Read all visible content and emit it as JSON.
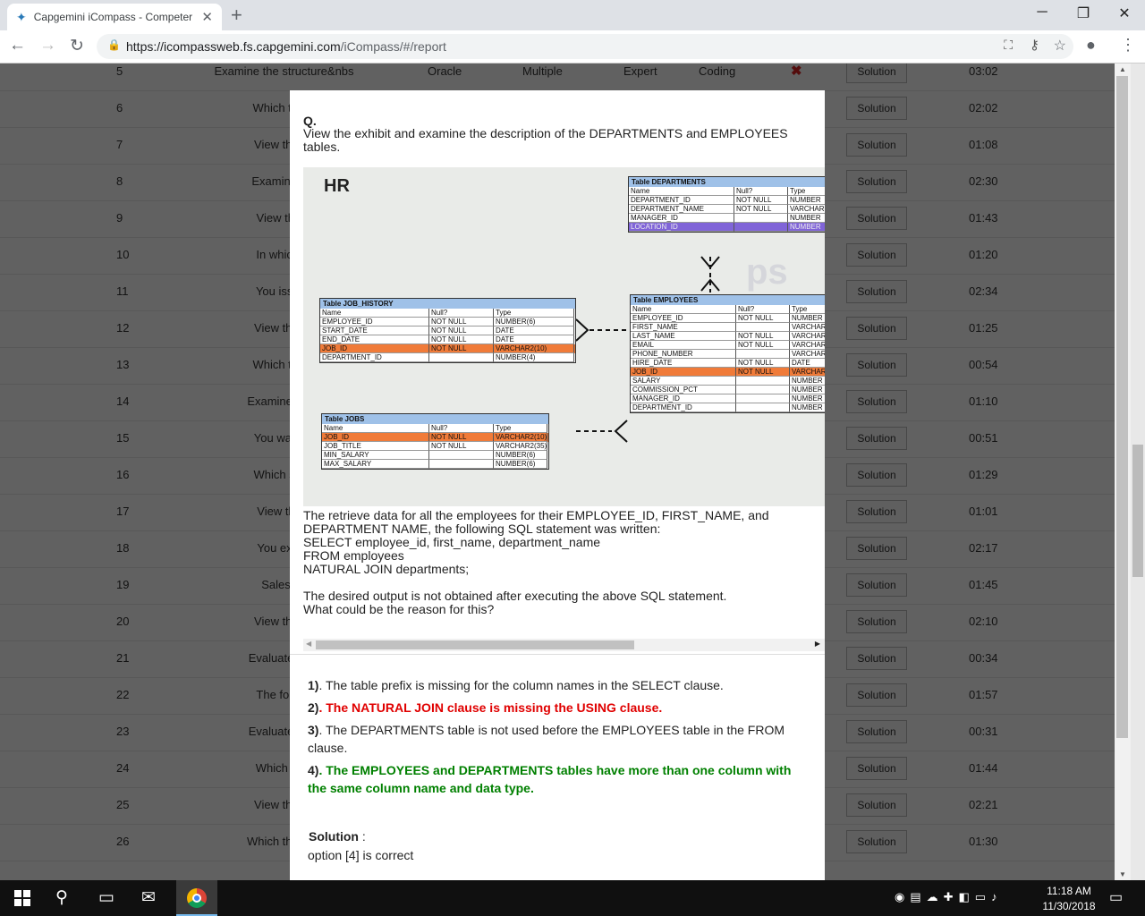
{
  "browser": {
    "tab_title": "Capgemini iCompass - Competer",
    "url_host": "https://icompassweb.fs.capgemini.com",
    "url_path": "/iCompass/#/report"
  },
  "table": {
    "solution_label": "Solution",
    "rows": [
      {
        "num": "5",
        "question": "Examine the structure&nbs",
        "c3": "Oracle",
        "c4": "Multiple",
        "c5": "Expert",
        "c6": "Coding",
        "wrong": true,
        "time": "03:02"
      },
      {
        "num": "6",
        "question": "Which two s",
        "time": "02:02"
      },
      {
        "num": "7",
        "question": "View the ex",
        "time": "01:08"
      },
      {
        "num": "8",
        "question": "Examine the",
        "time": "02:30"
      },
      {
        "num": "9",
        "question": "View the E",
        "time": "01:43"
      },
      {
        "num": "10",
        "question": "In which th",
        "time": "01:20"
      },
      {
        "num": "11",
        "question": "You issue t",
        "time": "02:34"
      },
      {
        "num": "12",
        "question": "View the ex",
        "time": "01:25"
      },
      {
        "num": "13",
        "question": "Which two s",
        "time": "00:54"
      },
      {
        "num": "14",
        "question": "Examine the s",
        "time": "01:10"
      },
      {
        "num": "15",
        "question": "You want to",
        "time": "00:51"
      },
      {
        "num": "16",
        "question": "Which state",
        "time": "01:29"
      },
      {
        "num": "17",
        "question": "View the e",
        "time": "01:01"
      },
      {
        "num": "18",
        "question": "You execu",
        "time": "02:17"
      },
      {
        "num": "19",
        "question": "Sales da",
        "time": "01:45"
      },
      {
        "num": "20",
        "question": "View the ex",
        "time": "02:10"
      },
      {
        "num": "21",
        "question": "Evaluate the f",
        "time": "00:34"
      },
      {
        "num": "22",
        "question": "The followi",
        "time": "01:57"
      },
      {
        "num": "23",
        "question": "Evaluate the f",
        "time": "00:31"
      },
      {
        "num": "24",
        "question": "Which task",
        "time": "01:44"
      },
      {
        "num": "25",
        "question": "View the ex",
        "time": "02:21"
      },
      {
        "num": "26",
        "question": "Which three st",
        "time": "01:30"
      }
    ]
  },
  "modal": {
    "q_label": "Q.",
    "question": "View the exhibit and examine the description of the DEPARTMENTS and EMPLOYEES tables.",
    "exhibit": {
      "schema": "HR",
      "departments": {
        "title": "Table DEPARTMENTS",
        "header": [
          "Name",
          "Null?",
          "Type"
        ],
        "rows": [
          [
            "DEPARTMENT_ID",
            "NOT NULL",
            "NUMBER"
          ],
          [
            "DEPARTMENT_NAME",
            "NOT NULL",
            "VARCHAR"
          ],
          [
            "MANAGER_ID",
            "",
            "NUMBER"
          ],
          [
            "LOCATION_ID",
            "",
            "NUMBER"
          ]
        ]
      },
      "employees": {
        "title": "Table EMPLOYEES",
        "header": [
          "Name",
          "Null?",
          "Type"
        ],
        "rows": [
          [
            "EMPLOYEE_ID",
            "NOT NULL",
            "NUMBER"
          ],
          [
            "FIRST_NAME",
            "",
            "VARCHAR"
          ],
          [
            "LAST_NAME",
            "NOT NULL",
            "VARCHAR"
          ],
          [
            "EMAIL",
            "NOT NULL",
            "VARCHAR"
          ],
          [
            "PHONE_NUMBER",
            "",
            "VARCHAR"
          ],
          [
            "HIRE_DATE",
            "NOT NULL",
            "DATE"
          ],
          [
            "JOB_ID",
            "NOT NULL",
            "VARCHAR"
          ],
          [
            "SALARY",
            "",
            "NUMBER"
          ],
          [
            "COMMISSION_PCT",
            "",
            "NUMBER"
          ],
          [
            "MANAGER_ID",
            "",
            "NUMBER"
          ],
          [
            "DEPARTMENT_ID",
            "",
            "NUMBER"
          ]
        ]
      },
      "job_history": {
        "title": "Table JOB_HISTORY",
        "header": [
          "Name",
          "Null?",
          "Type"
        ],
        "rows": [
          [
            "EMPLOYEE_ID",
            "NOT NULL",
            "NUMBER(6)"
          ],
          [
            "START_DATE",
            "NOT NULL",
            "DATE"
          ],
          [
            "END_DATE",
            "NOT NULL",
            "DATE"
          ],
          [
            "JOB_ID",
            "NOT NULL",
            "VARCHAR2(10)"
          ],
          [
            "DEPARTMENT_ID",
            "",
            "NUMBER(4)"
          ]
        ]
      },
      "jobs": {
        "title": "Table JOBS",
        "header": [
          "Name",
          "Null?",
          "Type"
        ],
        "rows": [
          [
            "JOB_ID",
            "NOT NULL",
            "VARCHAR2(10)"
          ],
          [
            "JOB_TITLE",
            "NOT NULL",
            "VARCHAR2(35)"
          ],
          [
            "MIN_SALARY",
            "",
            "NUMBER(6)"
          ],
          [
            "MAX_SALARY",
            "",
            "NUMBER(6)"
          ]
        ]
      }
    },
    "body": [
      "The retrieve data for all the employees for their EMPLOYEE_ID, FIRST_NAME, and",
      "DEPARTMENT NAME, the following SQL statement was written:",
      "SELECT employee_id, first_name, department_name",
      "FROM employees",
      "NATURAL JOIN departments;",
      "",
      "The desired output is not obtained after executing the above SQL statement.",
      "What could be the reason for this?"
    ],
    "options": [
      {
        "num": "1)",
        "text": ". The table prefix is missing for the column names in the SELECT clause."
      },
      {
        "num": "2)",
        "text": ". The NATURAL JOIN clause is missing the USING clause."
      },
      {
        "num": "3)",
        "text": ". The DEPARTMENTS table is not used before the EMPLOYEES table in the FROM clause."
      },
      {
        "num": "4)",
        "text": ". The EMPLOYEES and DEPARTMENTS tables have more than one column with the same column name and data type."
      }
    ],
    "solution_heading": "Solution",
    "solution_sep": " :",
    "solution_text": "option [4] is correct"
  },
  "taskbar": {
    "time": "11:18 AM",
    "date": "11/30/2018"
  }
}
